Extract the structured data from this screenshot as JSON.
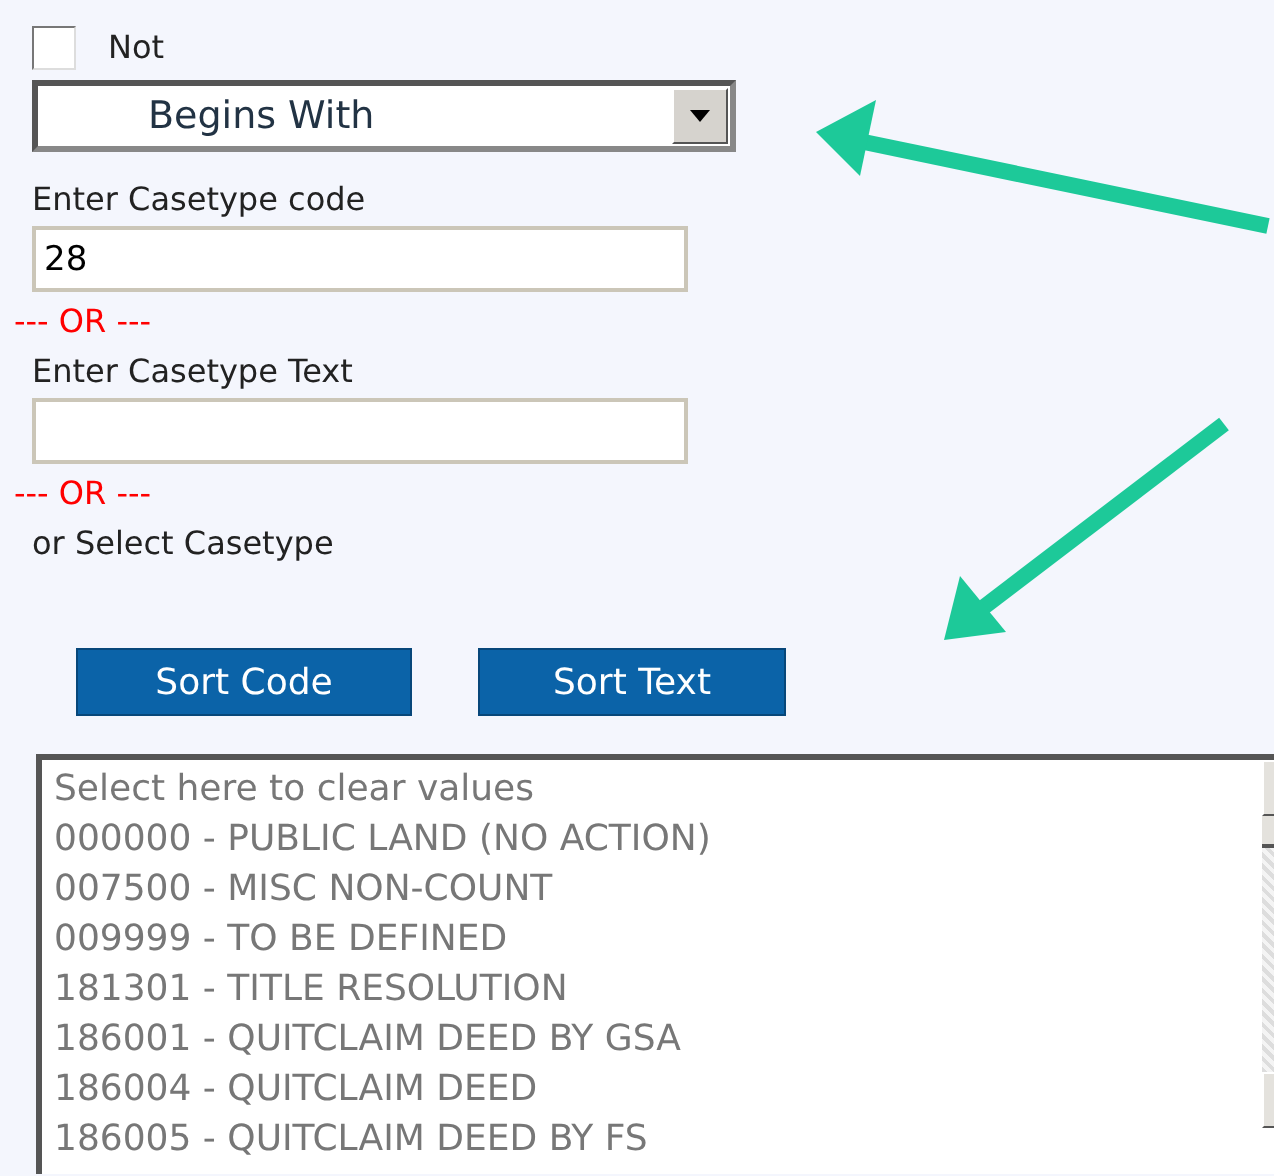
{
  "not_checkbox": {
    "label": "Not",
    "checked": false
  },
  "match_dropdown": {
    "value": "Begins With"
  },
  "code_field": {
    "label": "Enter Casetype code",
    "value": "28"
  },
  "separator_1": "--- OR ---",
  "text_field": {
    "label": "Enter Casetype Text"
  },
  "separator_2": "--- OR ---",
  "select_label": "or Select Casetype",
  "buttons": [
    "Sort Code",
    "Sort Text"
  ],
  "casetype_list": [
    "Select here to clear values",
    "000000 - PUBLIC LAND (NO ACTION)",
    "007500 - MISC NON-COUNT",
    "009999 - TO BE DEFINED",
    "181301 - TITLE RESOLUTION",
    "186001 - QUITCLAIM DEED BY GSA",
    "186004 - QUITCLAIM DEED",
    "186005 - QUITCLAIM DEED BY FS"
  ]
}
